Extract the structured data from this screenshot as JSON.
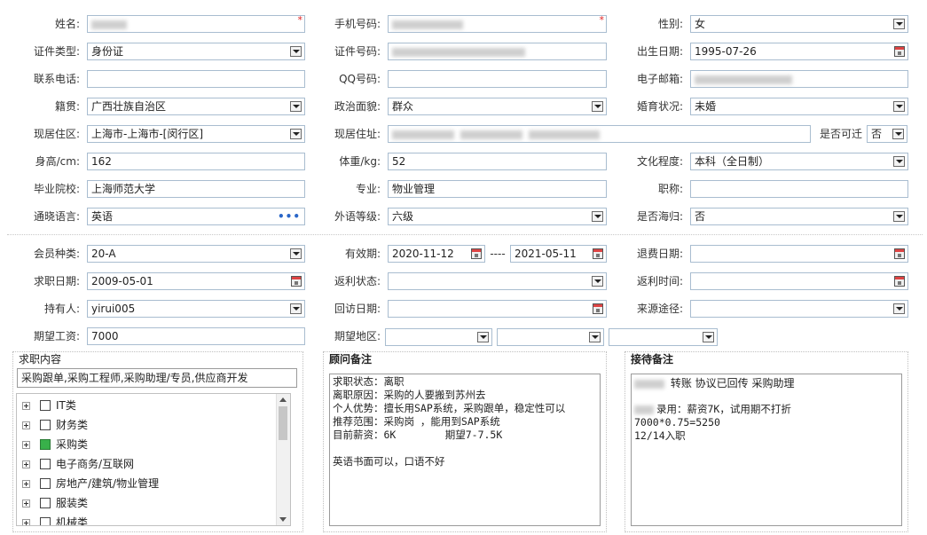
{
  "personal": {
    "name_label": "姓名:",
    "phone_label": "手机号码:",
    "gender_label": "性别:",
    "gender_value": "女",
    "id_type_label": "证件类型:",
    "id_type_value": "身份证",
    "id_no_label": "证件号码:",
    "birth_label": "出生日期:",
    "birth_value": "1995-07-26",
    "contact_phone_label": "联系电话:",
    "qq_label": "QQ号码:",
    "email_label": "电子邮箱:",
    "native_label": "籍贯:",
    "native_value": "广西壮族自治区",
    "political_label": "政治面貌:",
    "political_value": "群众",
    "marital_label": "婚育状况:",
    "marital_value": "未婚",
    "residence_label": "现居住区:",
    "residence_value": "上海市-上海市-[闵行区]",
    "address_label": "现居住址:",
    "relocate_label": "是否可迁",
    "relocate_value": "否",
    "height_label": "身高/cm:",
    "height_value": "162",
    "weight_label": "体重/kg:",
    "weight_value": "52",
    "education_label": "文化程度:",
    "education_value": "本科（全日制）",
    "school_label": "毕业院校:",
    "school_value": "上海师范大学",
    "major_label": "专业:",
    "major_value": "物业管理",
    "title_label": "职称:",
    "language_label": "通晓语言:",
    "language_value": "英语",
    "lang_level_label": "外语等级:",
    "lang_level_value": "六级",
    "returnee_label": "是否海归:",
    "returnee_value": "否",
    "required_mark": "*",
    "more_mark": "•••"
  },
  "member": {
    "type_label": "会员种类:",
    "type_value": "20-A",
    "valid_label": "有效期:",
    "valid_from": "2020-11-12",
    "valid_sep": "----",
    "valid_to": "2021-05-11",
    "refund_date_label": "退费日期:",
    "apply_date_label": "求职日期:",
    "apply_date_value": "2009-05-01",
    "rebate_status_label": "返利状态:",
    "rebate_time_label": "返利时间:",
    "holder_label": "持有人:",
    "holder_value": "yirui005",
    "visit_date_label": "回访日期:",
    "source_label": "来源途径:",
    "salary_label": "期望工资:",
    "salary_value": "7000",
    "region_label": "期望地区:"
  },
  "job_panel": {
    "title": "求职内容",
    "summary": "采购跟单,采购工程师,采购助理/专员,供应商开发",
    "tree": [
      {
        "label": "IT类",
        "checked": false
      },
      {
        "label": "财务类",
        "checked": false
      },
      {
        "label": "采购类",
        "checked": true
      },
      {
        "label": "电子商务/互联网",
        "checked": false
      },
      {
        "label": "房地产/建筑/物业管理",
        "checked": false
      },
      {
        "label": "服装类",
        "checked": false
      },
      {
        "label": "机械类",
        "checked": false
      }
    ]
  },
  "advisor_panel": {
    "title": "顾问备注",
    "text": "求职状态：离职\n离职原因：采购的人要搬到苏州去\n个人优势：擅长用SAP系统，采购跟单，稳定性可以\n推荐范围：采购岗 ，能用到SAP系统\n目前薪资：6K        期望7-7.5K\n\n英语书面可以，口语不好"
  },
  "reception_panel": {
    "title": "接待备注",
    "line1": "转账 协议已回传 采购助理",
    "line2": "录用：薪资7K，试用期不打折",
    "line3": "7000*0.75=5250",
    "line4": "12/14入职"
  },
  "colors": {
    "border": "#a9bdd0",
    "required": "#e02020",
    "checked": "#38b14a",
    "more_dots": "#2a66c8"
  }
}
